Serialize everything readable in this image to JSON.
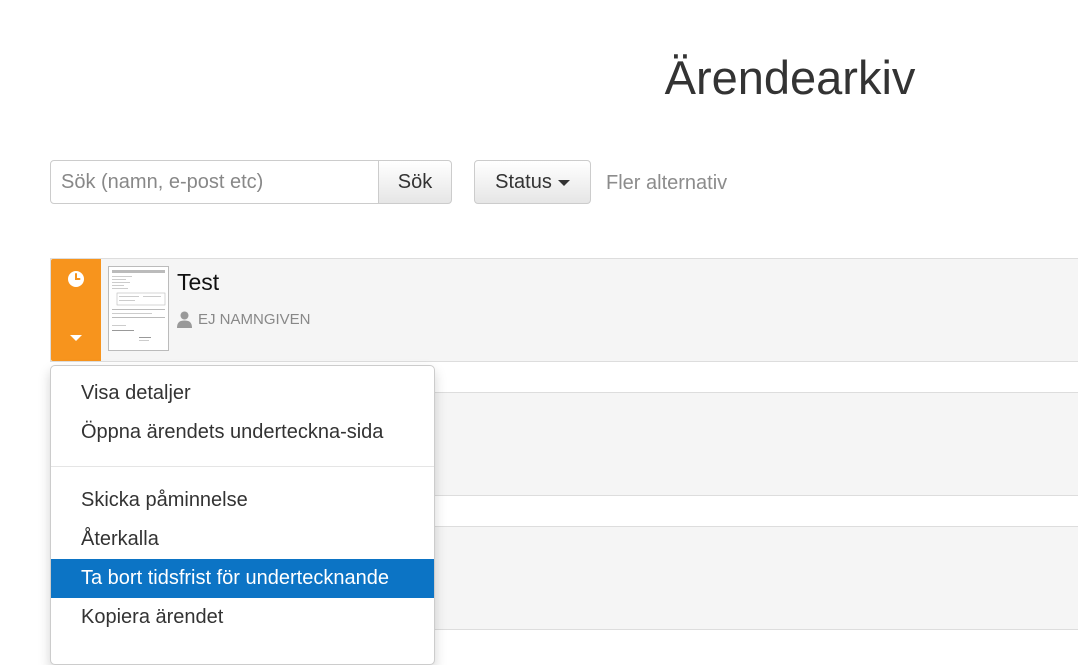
{
  "page": {
    "title": "Ärendearkiv"
  },
  "toolbar": {
    "search_placeholder": "Sök (namn, e-post etc)",
    "search_value": "",
    "search_button": "Sök",
    "status_button": "Status",
    "more_options": "Fler alternativ"
  },
  "cases": [
    {
      "title": "Test",
      "signer": "EJ NAMNGIVEN",
      "status_icon": "clock-icon",
      "status_color": "#f7941d"
    }
  ],
  "dropdown": {
    "group1": [
      "Visa detaljer",
      "Öppna ärendets underteckna-sida"
    ],
    "group2": [
      "Skicka påminnelse",
      "Återkalla",
      "Ta bort tidsfrist för undertecknande",
      "Kopiera ärendet"
    ],
    "active_item": "Ta bort tidsfrist för undertecknande",
    "active_color": "#0c74c5"
  }
}
